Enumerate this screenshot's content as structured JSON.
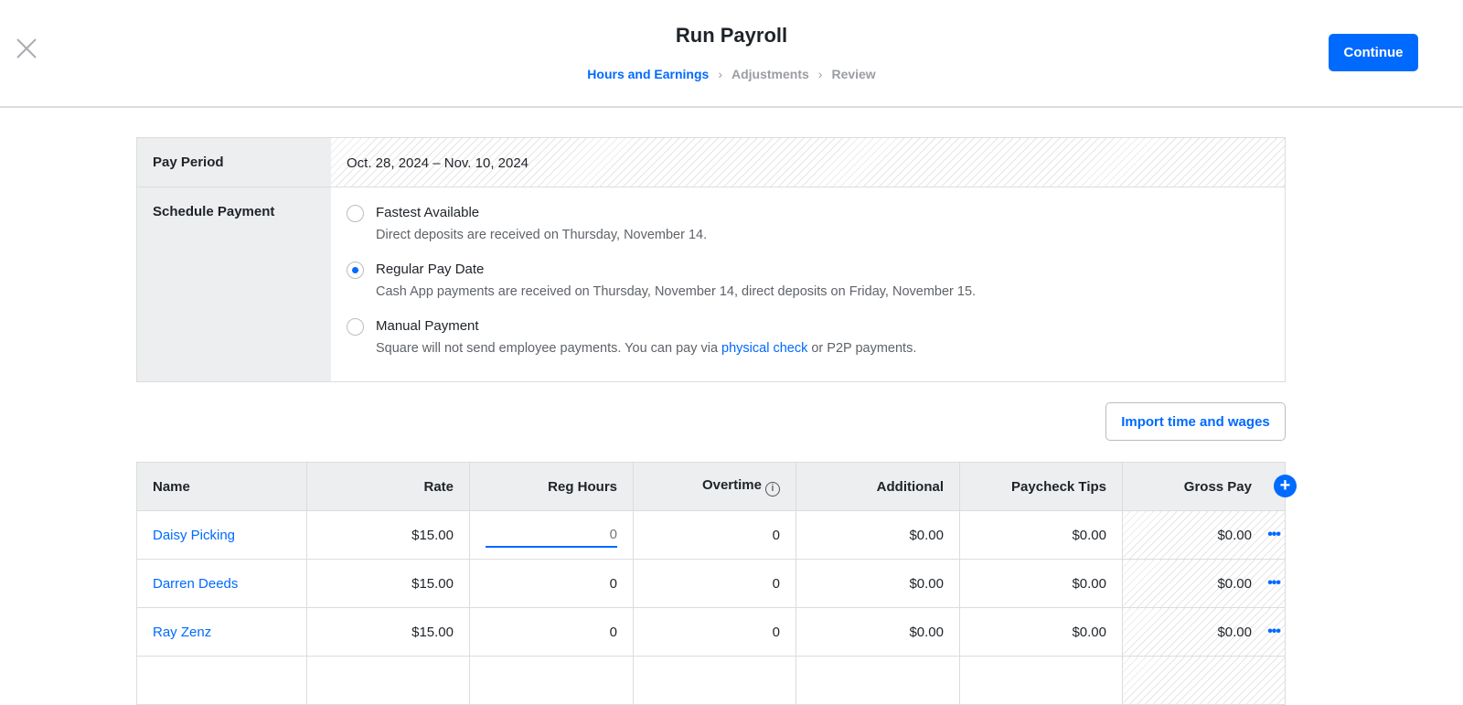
{
  "header": {
    "title": "Run Payroll",
    "continue": "Continue",
    "steps": [
      "Hours and Earnings",
      "Adjustments",
      "Review"
    ]
  },
  "pay_period": {
    "label": "Pay Period",
    "value": "Oct. 28, 2024 – Nov. 10, 2024"
  },
  "schedule": {
    "label": "Schedule Payment",
    "options": [
      {
        "title": "Fastest Available",
        "desc": "Direct deposits are received on Thursday, November 14.",
        "selected": false
      },
      {
        "title": "Regular Pay Date",
        "desc": "Cash App payments are received on Thursday, November 14, direct deposits on Friday, November 15.",
        "selected": true
      },
      {
        "title": "Manual Payment",
        "desc_pre": "Square will not send employee payments. You can pay via ",
        "desc_link": "physical check",
        "desc_post": " or P2P payments.",
        "selected": false
      }
    ]
  },
  "import_label": "Import time and wages",
  "table": {
    "headers": [
      "Name",
      "Rate",
      "Reg Hours",
      "Overtime",
      "Additional",
      "Paycheck Tips",
      "Gross Pay"
    ],
    "rows": [
      {
        "name": "Daisy Picking",
        "rate": "$15.00",
        "reg": "0",
        "ot": "0",
        "add": "$0.00",
        "tips": "$0.00",
        "gross": "$0.00"
      },
      {
        "name": "Darren Deeds",
        "rate": "$15.00",
        "reg": "0",
        "ot": "0",
        "add": "$0.00",
        "tips": "$0.00",
        "gross": "$0.00"
      },
      {
        "name": "Ray Zenz",
        "rate": "$15.00",
        "reg": "0",
        "ot": "0",
        "add": "$0.00",
        "tips": "$0.00",
        "gross": "$0.00"
      }
    ]
  },
  "colors": {
    "accent": "#006aff"
  }
}
